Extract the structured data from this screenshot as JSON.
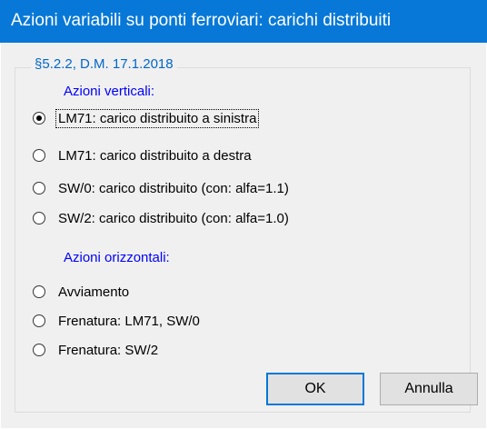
{
  "window": {
    "title": "Azioni variabili su ponti ferroviari: carichi distribuiti"
  },
  "group": {
    "title": "§5.2.2, D.M. 17.1.2018"
  },
  "vertical": {
    "heading": "Azioni verticali:",
    "options": [
      {
        "label": "LM71: carico distribuito a sinistra",
        "checked": true
      },
      {
        "label": "LM71: carico distribuito a destra",
        "checked": false
      },
      {
        "label": "SW/0: carico distribuito (con: alfa=1.1)",
        "checked": false
      },
      {
        "label": "SW/2: carico distribuito (con: alfa=1.0)",
        "checked": false
      }
    ]
  },
  "horizontal": {
    "heading": "Azioni orizzontali:",
    "options": [
      {
        "label": "Avviamento",
        "checked": false
      },
      {
        "label": "Frenatura: LM71, SW/0",
        "checked": false
      },
      {
        "label": "Frenatura: SW/2",
        "checked": false
      }
    ]
  },
  "buttons": {
    "ok": "OK",
    "cancel": "Annulla"
  }
}
